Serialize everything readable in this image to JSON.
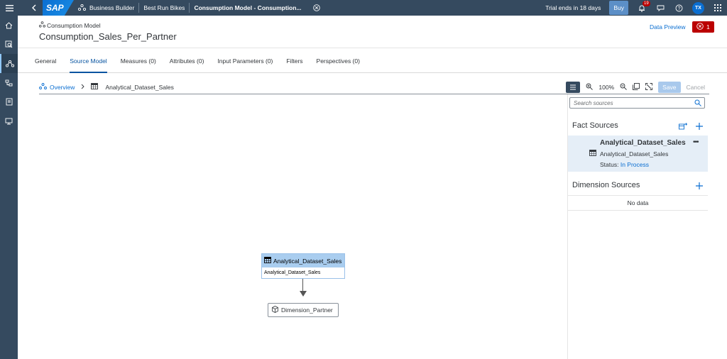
{
  "shell": {
    "logo": "SAP",
    "app_name": "Business Builder",
    "company": "Best Run Bikes",
    "model_title": "Consumption Model - Consumption...",
    "trial_text": "Trial ends in 18 days",
    "buy_label": "Buy",
    "notification_count": "19",
    "avatar_initials": "TX",
    "icons": [
      "menu-icon",
      "back-icon",
      "business-builder-icon",
      "close-circle-icon",
      "bell-icon",
      "feedback-icon",
      "help-icon",
      "grid-icon"
    ]
  },
  "sidenav": {
    "items": [
      "home-icon",
      "data-search-icon",
      "business-builder-icon",
      "data-model-icon",
      "story-icon",
      "presentation-icon"
    ]
  },
  "header": {
    "object_type": "Consumption Model",
    "title": "Consumption_Sales_Per_Partner",
    "data_preview": "Data Preview",
    "error_count": "1"
  },
  "tabs": [
    {
      "label": "General"
    },
    {
      "label": "Source Model"
    },
    {
      "label": "Measures (0)"
    },
    {
      "label": "Attributes (0)"
    },
    {
      "label": "Input Parameters (0)"
    },
    {
      "label": "Filters"
    },
    {
      "label": "Perspectives (0)"
    }
  ],
  "active_tab": "Source Model",
  "toolbar": {
    "overview": "Overview",
    "current": "Analytical_Dataset_Sales",
    "zoom": "100%",
    "save": "Save",
    "cancel": "Cancel"
  },
  "canvas": {
    "fact_node": {
      "title": "Analytical_Dataset_Sales",
      "subtitle": "Analytical_Dataset_Sales"
    },
    "dimension_node": {
      "title": "Dimension_Partner"
    }
  },
  "panel": {
    "search_placeholder": "Search sources",
    "fact_sources_title": "Fact Sources",
    "fact_item": {
      "title": "Analytical_Dataset_Sales",
      "subtitle": "Analytical_Dataset_Sales",
      "status_label": "Status:",
      "status_value": "In Process"
    },
    "dimension_sources_title": "Dimension Sources",
    "no_data": "No data"
  },
  "colors": {
    "shell": "#354a5f",
    "accent": "#0a6ed1",
    "error": "#bb0000",
    "selected_item": "#e5eef7",
    "node_header": "#a9cdef"
  }
}
